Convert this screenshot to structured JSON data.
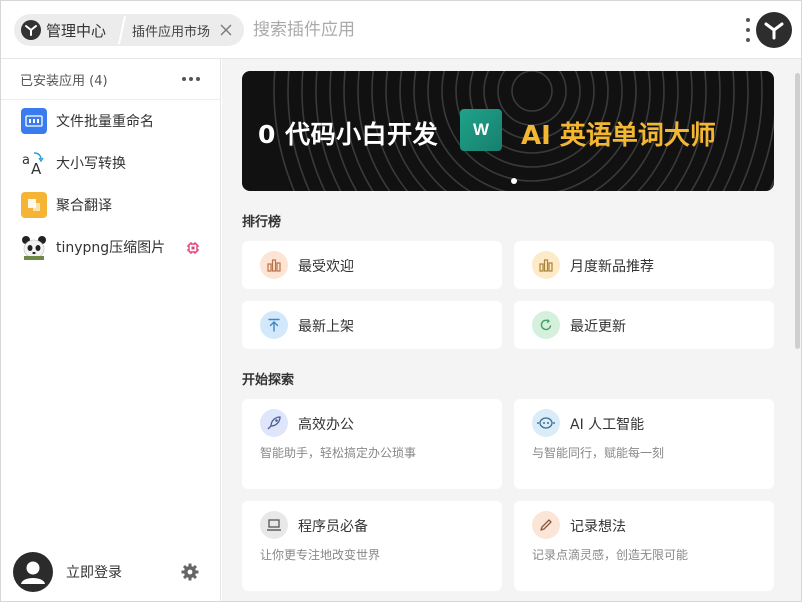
{
  "header": {
    "home_label": "管理中心",
    "tab_label": "插件应用市场",
    "search_placeholder": "搜索插件应用"
  },
  "sidebar": {
    "title": "已安装应用 (4)",
    "items": [
      {
        "label": "文件批量重命名",
        "icon": "file-rename-icon",
        "color": "#3a7bf0"
      },
      {
        "label": "大小写转换",
        "icon": "case-convert-icon",
        "color": "#333333"
      },
      {
        "label": "聚合翻译",
        "icon": "translate-icon",
        "color": "#f6b436"
      },
      {
        "label": "tinypng压缩图片",
        "icon": "panda-icon",
        "color": "#222222"
      }
    ],
    "login_label": "立即登录"
  },
  "banner": {
    "left_text": "0 代码小白开发",
    "logo_letter": "W",
    "right_text": "AI 英语单词大师"
  },
  "ranking": {
    "title": "排行榜",
    "cards": [
      {
        "label": "最受欢迎",
        "icon": "bar-chart-icon",
        "bg": "#fde4d4",
        "fg": "#b9714a"
      },
      {
        "label": "月度新品推荐",
        "icon": "bar-chart-icon",
        "bg": "#fdeac6",
        "fg": "#a9833a"
      },
      {
        "label": "最新上架",
        "icon": "upload-icon",
        "bg": "#d3e9fb",
        "fg": "#3d86c6"
      },
      {
        "label": "最近更新",
        "icon": "refresh-icon",
        "bg": "#d5f0dd",
        "fg": "#45a063"
      }
    ]
  },
  "explore": {
    "title": "开始探索",
    "cards": [
      {
        "label": "高效办公",
        "desc": "智能助手，轻松搞定办公琐事",
        "icon": "rocket-icon",
        "bg": "#dfe6fb",
        "fg": "#4a5f9a"
      },
      {
        "label": "AI 人工智能",
        "desc": "与智能同行，赋能每一刻",
        "icon": "robot-icon",
        "bg": "#d9ecf8",
        "fg": "#3c6f95"
      },
      {
        "label": "程序员必备",
        "desc": "让你更专注地改变世界",
        "icon": "laptop-icon",
        "bg": "#e8e8e8",
        "fg": "#555555"
      },
      {
        "label": "记录想法",
        "desc": "记录点滴灵感，创造无限可能",
        "icon": "pencil-icon",
        "bg": "#fbe5d6",
        "fg": "#8c5a3c"
      }
    ]
  }
}
